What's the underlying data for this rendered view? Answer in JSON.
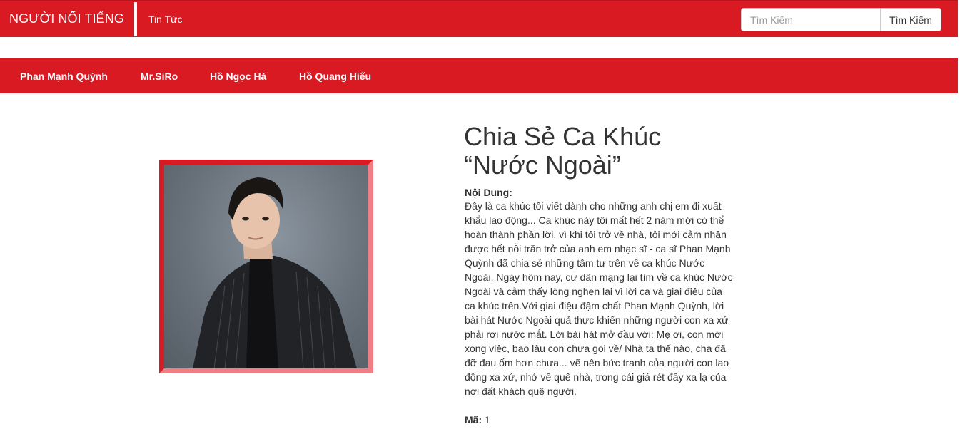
{
  "header": {
    "brand": "NGƯỜI NỔI TIẾNG",
    "news_link": "Tin Tức",
    "search": {
      "placeholder": "Tìm Kiếm",
      "button_label": "Tìm Kiếm"
    }
  },
  "categories": [
    "Phan Mạnh Quỳnh",
    "Mr.SiRo",
    "Hồ Ngọc Hà",
    "Hồ Quang Hiếu"
  ],
  "article": {
    "title": "Chia Sẻ Ca Khúc “Nước Ngoài”",
    "content_label": "Nội Dung:",
    "content": "Đây là ca khúc tôi viết dành cho những anh chị em đi xuất khẩu lao động... Ca khúc này tôi mất hết 2 năm mới có thể hoàn thành phần lời, vì khi tôi trở về nhà, tôi mới cảm nhận được hết nỗi trăn trở của anh em nhạc sĩ - ca sĩ Phan Mạnh Quỳnh đã chia sẻ những tâm tư trên về ca khúc Nước Ngoài. Ngày hôm nay, cư dân mạng lại tìm về ca khúc Nước Ngoài và cảm thấy lòng nghẹn lại vì lời ca và giai điệu của ca khúc trên.Với giai điệu đậm chất Phan Mạnh Quỳnh, lời bài hát Nước Ngoài quả thực khiến những người con xa xứ phải rơi nước mắt. Lời bài hát mở đầu với: Mẹ ơi, con mới xong việc, bao lâu con chưa gọi về/ Nhà ta thế nào, cha đã đỡ đau ốm hơn chưa... vẽ nên bức tranh của người con lao động xa xứ, nhớ về quê nhà, trong cái giá rét đầy xa lạ của nơi đất khách quê người.",
    "code_label": "Mã:",
    "code_value": "1"
  },
  "colors": {
    "brand_red": "#d91a22",
    "frame_pink": "#f07e84"
  }
}
